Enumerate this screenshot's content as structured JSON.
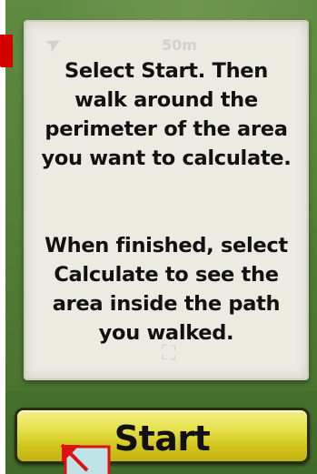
{
  "instructions": {
    "paragraph_1": "Select Start. Then\nwalk around the\nperimeter of the area\nyou want to calculate.",
    "paragraph_2": "When finished, select\nCalculate to see the\narea inside the path\nyou walked."
  },
  "map": {
    "scale_label": "50m"
  },
  "start_button": {
    "label": "Start"
  },
  "colors": {
    "map_green": "#537f37",
    "panel": "#ecebe2",
    "button_yellow": "#e6e04a",
    "highlight_red": "#d40000"
  }
}
